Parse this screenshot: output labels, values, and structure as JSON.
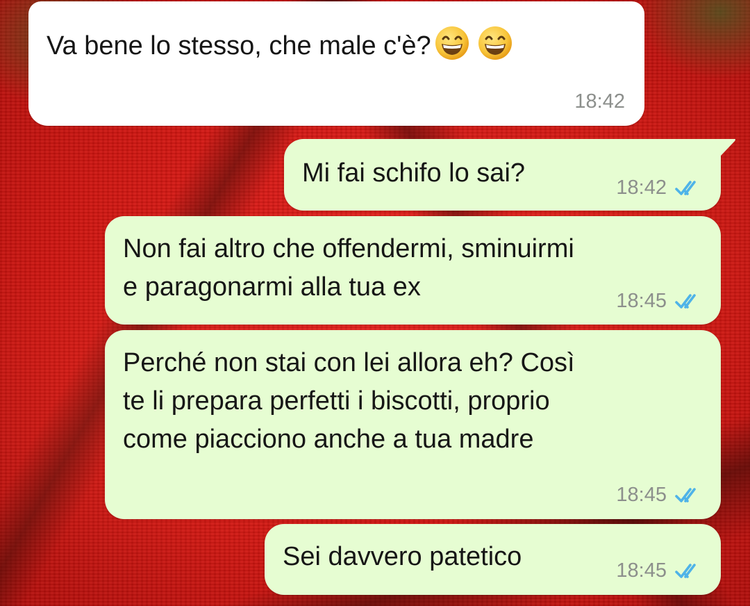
{
  "chat": {
    "messages": [
      {
        "direction": "incoming",
        "text": "Va bene lo stesso, che male c'è?",
        "emoji": [
          "grinning-face-with-smiling-eyes",
          "grinning-face-with-smiling-eyes"
        ],
        "time": "18:42"
      },
      {
        "direction": "outgoing",
        "text": "Mi fai schifo lo sai?",
        "time": "18:42",
        "status": "read"
      },
      {
        "direction": "outgoing",
        "lines": [
          "Non fai altro che offendermi, sminuirmi",
          "e paragonarmi alla tua ex"
        ],
        "time": "18:45",
        "status": "read"
      },
      {
        "direction": "outgoing",
        "lines": [
          "Perché non stai con lei allora eh? Così",
          "te li prepara perfetti i biscotti, proprio",
          "come piacciono anche a tua madre"
        ],
        "time": "18:45",
        "status": "read"
      },
      {
        "direction": "outgoing",
        "text": "Sei davvero patetico",
        "time": "18:45",
        "status": "read"
      }
    ]
  },
  "colors": {
    "incoming_bubble": "#ffffff",
    "outgoing_bubble": "#e6fdd2",
    "read_tick": "#4fb3e8",
    "timestamp": "#8c8f8c",
    "wallpaper": "#d81a15"
  },
  "icons": {
    "read_receipt": "double-check-icon",
    "emoji": "grinning-face-icon"
  }
}
